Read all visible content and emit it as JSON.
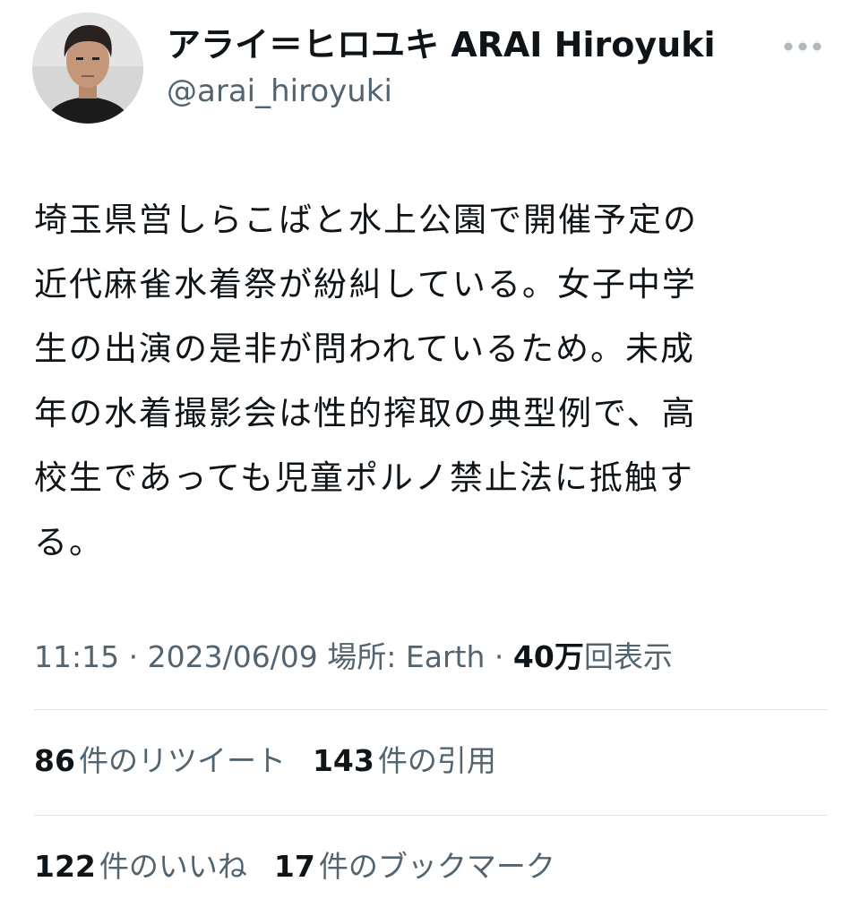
{
  "author": {
    "display_name": "アライ＝ヒロユキ  ARAI Hiroyuki",
    "handle": "@arai_hiroyuki"
  },
  "icons": {
    "avatar": "avatar-photo",
    "more": "more-dots-icon"
  },
  "tweet": {
    "text": "埼玉県営しらこばと水上公園で開催予定の\n近代麻雀水着祭が紛糾している。女子中学\n生の出演の是非が問われているため。未成\n年の水着撮影会は性的搾取の典型例で、高\n校生であっても児童ポルノ禁止法に抵触す\nる。"
  },
  "meta": {
    "time": "11:15",
    "sep1": " · ",
    "date": "2023/06/09",
    "place_label": " 場所: ",
    "place": "Earth",
    "sep2": " · ",
    "views_count": "40万",
    "views_label": "回表示"
  },
  "stats": {
    "retweets_count": "86",
    "retweets_label": "件のリツイート",
    "quotes_count": "143",
    "quotes_label": "件の引用",
    "likes_count": "122",
    "likes_label": "件のいいね",
    "bookmarks_count": "17",
    "bookmarks_label": "件のブックマーク"
  },
  "colors": {
    "text_primary": "#0f1419",
    "text_secondary": "#536471",
    "divider": "#e1e4e8",
    "more_dots": "#b0b8bf"
  }
}
